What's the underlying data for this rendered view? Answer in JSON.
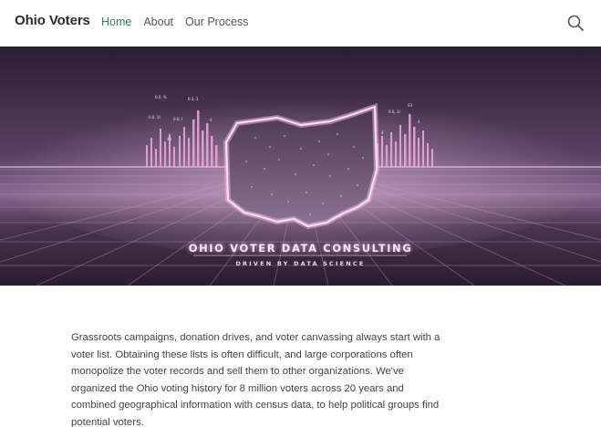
{
  "navbar": {
    "brand": "Ohio Voters",
    "links": [
      {
        "label": "Home",
        "active": true
      },
      {
        "label": "About",
        "active": false
      },
      {
        "label": "Our Process",
        "active": false
      }
    ],
    "search_icon": "search-icon"
  },
  "hero": {
    "title": "OHIO VOTER DATA CONSULTING",
    "subtitle": "DRIVEN BY DATA SCIENCE",
    "colors": {
      "background": "#3a2740",
      "glow": "#f3b6e6",
      "grid": "#b98cb6"
    }
  },
  "intro": {
    "text": "Grassroots campaigns, donation drives, and voter canvassing always start with a voter list. Obtaining these lists is often difficult, and large corporations often monopolize the voter records and sell them to other organizations. We've organized the Ohio voting history for 8 million voters across 20 years and combined geographical information with census data, to help political groups find potential voters."
  }
}
